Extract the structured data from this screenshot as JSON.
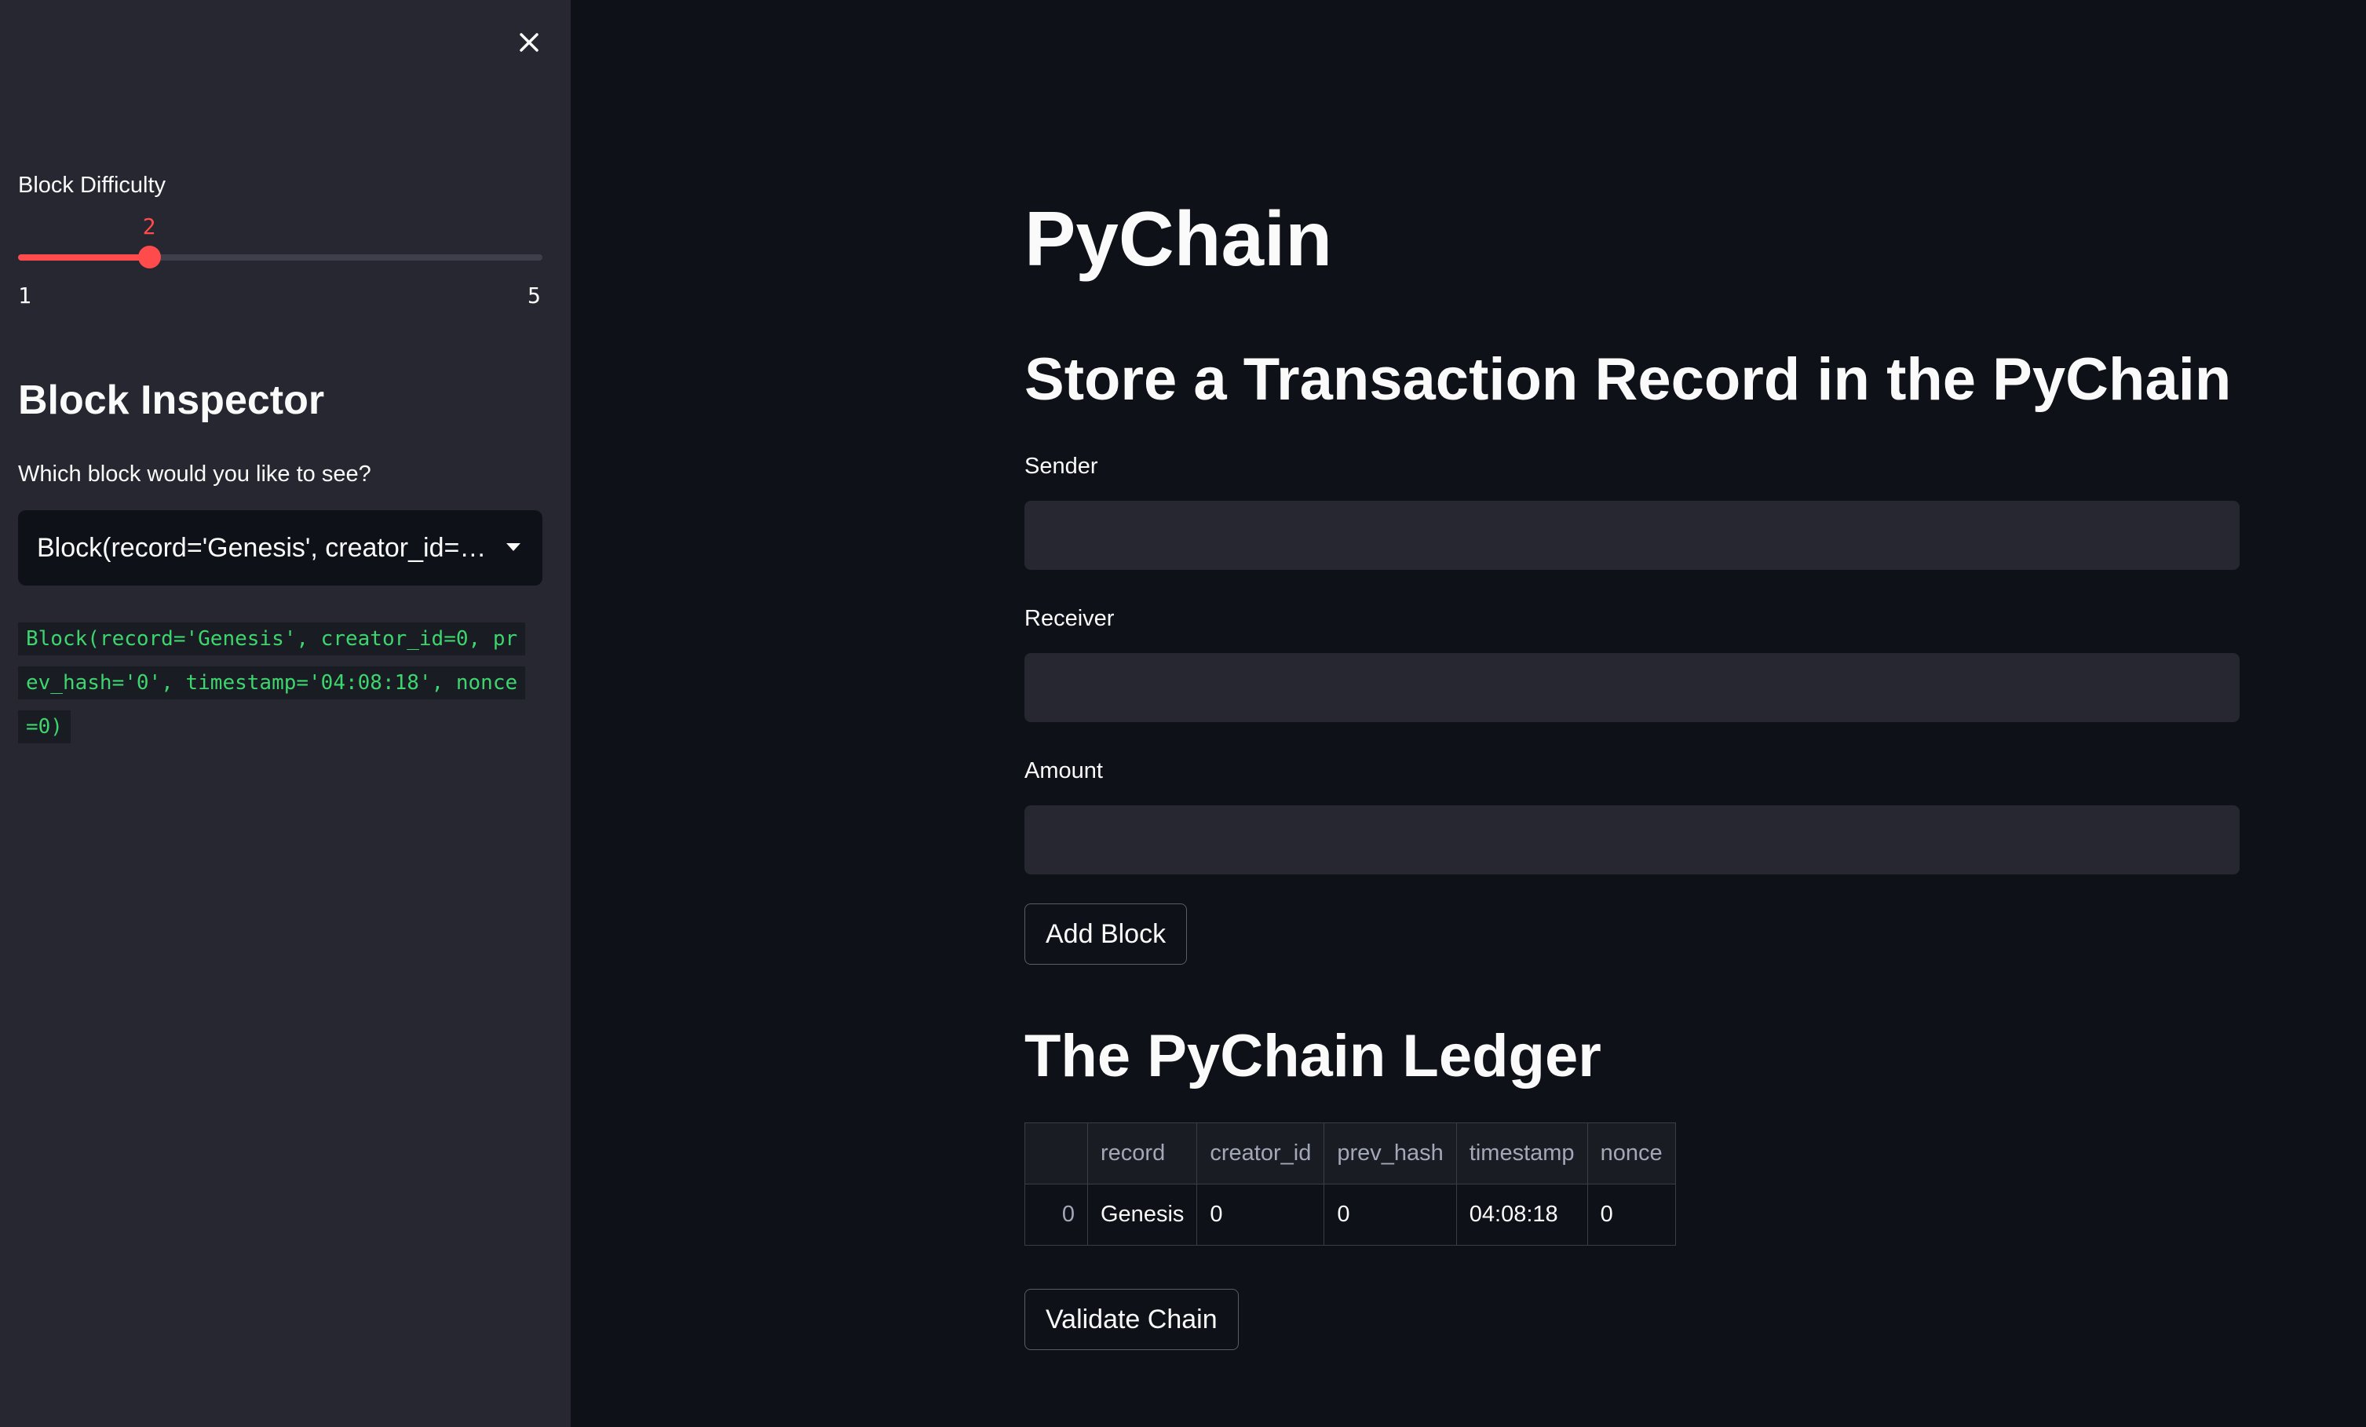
{
  "sidebar": {
    "close_label": "×",
    "difficulty": {
      "label": "Block Difficulty",
      "value": "2",
      "min": "1",
      "max": "5",
      "fraction": 0.25,
      "accent_color": "#ff4b4b"
    },
    "inspector": {
      "heading": "Block Inspector",
      "question": "Which block would you like to see?",
      "selected": "Block(record='Genesis', creator_id=0, prev_hash='0', timestamp='04:08:18', nonce=0)",
      "code": "Block(record='Genesis', creator_id=0, prev_hash='0', timestamp='04:08:18', nonce=0)"
    }
  },
  "main": {
    "title": "PyChain",
    "form_heading": "Store a Transaction Record in the PyChain",
    "fields": {
      "sender_label": "Sender",
      "sender_value": "",
      "receiver_label": "Receiver",
      "receiver_value": "",
      "amount_label": "Amount",
      "amount_value": ""
    },
    "add_block_label": "Add Block",
    "ledger_heading": "The PyChain Ledger",
    "ledger": {
      "columns": [
        "",
        "record",
        "creator_id",
        "prev_hash",
        "timestamp",
        "nonce"
      ],
      "rows": [
        [
          "0",
          "Genesis",
          "0",
          "0",
          "04:08:18",
          "0"
        ]
      ]
    },
    "validate_label": "Validate Chain"
  },
  "colors": {
    "background": "#0e1117",
    "sidebar": "#262730",
    "accent": "#ff4b4b",
    "code_text": "#3dd56d"
  },
  "icons": [
    "close-icon",
    "chevron-down-icon"
  ]
}
